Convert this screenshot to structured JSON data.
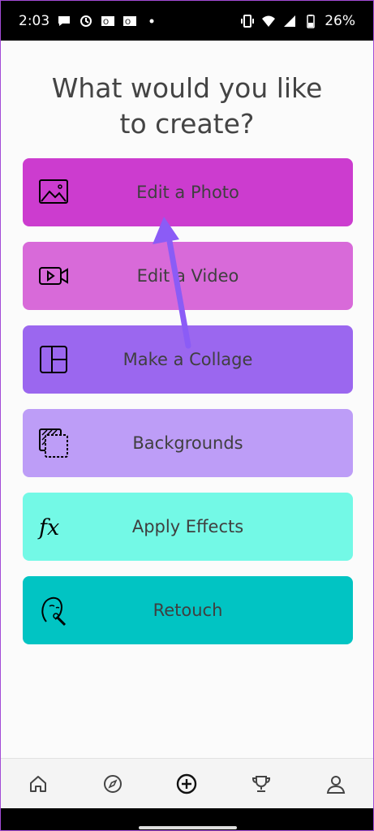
{
  "status_bar": {
    "time": "2:03",
    "battery": "26%",
    "left_icons": [
      "message-icon",
      "sync-icon",
      "outlook-icon",
      "outlook-icon",
      "dot-icon"
    ],
    "right_icons": [
      "vibrate-icon",
      "wifi-icon",
      "signal-icon",
      "battery-icon"
    ]
  },
  "heading": "What would you like to create?",
  "options": [
    {
      "label": "Edit a Photo",
      "icon": "photo-icon",
      "color": "#cc3ccf"
    },
    {
      "label": "Edit a Video",
      "icon": "video-camera-icon",
      "color": "#d86ad9"
    },
    {
      "label": "Make a Collage",
      "icon": "collage-icon",
      "color": "#9b67ef"
    },
    {
      "label": "Backgrounds",
      "icon": "backgrounds-icon",
      "color": "#bd9df7"
    },
    {
      "label": "Apply Effects",
      "icon": "fx-icon",
      "color": "#73f9e6"
    },
    {
      "label": "Retouch",
      "icon": "retouch-icon",
      "color": "#01c4c3"
    }
  ],
  "annotation": {
    "color": "#8b5cf6"
  },
  "bottom_nav": [
    "home-icon",
    "compass-icon",
    "add-circle-icon",
    "trophy-icon",
    "profile-icon"
  ]
}
